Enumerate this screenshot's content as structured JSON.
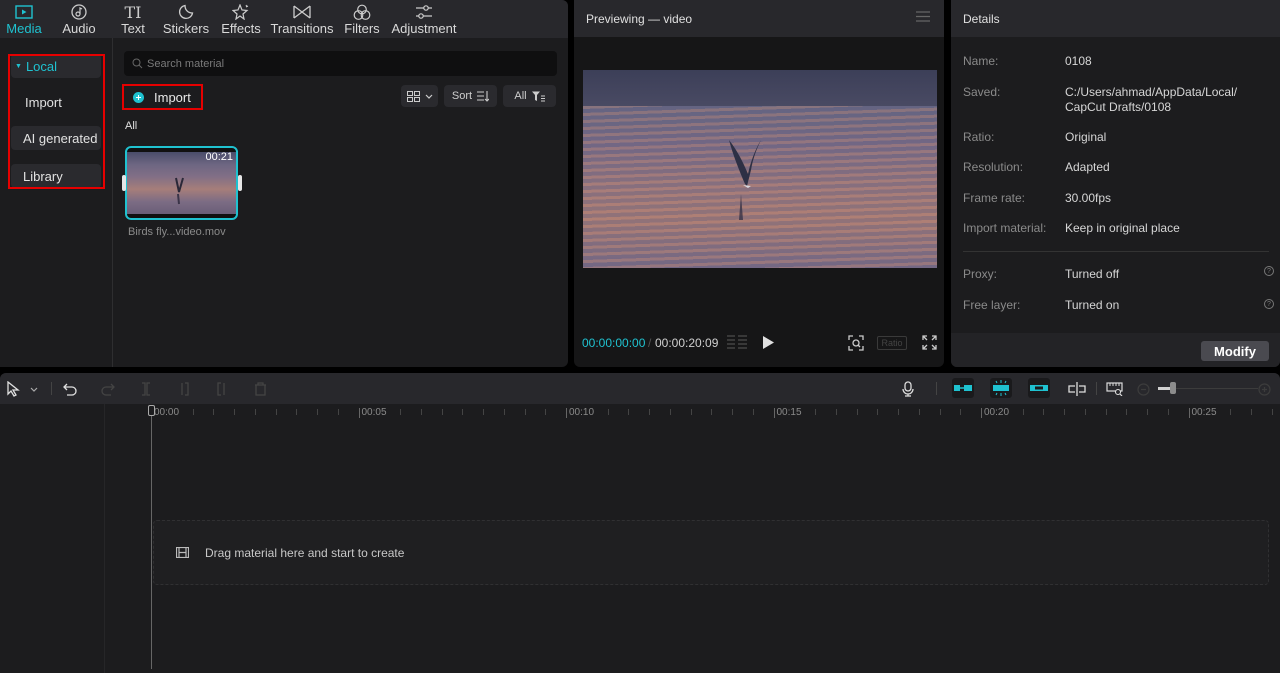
{
  "media_tabs": [
    {
      "label": "Media",
      "icon": "media-icon",
      "active": true
    },
    {
      "label": "Audio",
      "icon": "audio-icon",
      "active": false
    },
    {
      "label": "Text",
      "icon": "text-icon",
      "active": false
    },
    {
      "label": "Stickers",
      "icon": "stickers-icon",
      "active": false
    },
    {
      "label": "Effects",
      "icon": "effects-icon",
      "active": false
    },
    {
      "label": "Transitions",
      "icon": "transitions-icon",
      "active": false
    },
    {
      "label": "Filters",
      "icon": "filters-icon",
      "active": false
    },
    {
      "label": "Adjustment",
      "icon": "adjustment-icon",
      "active": false
    }
  ],
  "sidebar": {
    "items": [
      {
        "label": "Local",
        "expanded": true
      },
      {
        "label": "Import"
      },
      {
        "label": "AI generated"
      },
      {
        "label": "Library"
      }
    ]
  },
  "media": {
    "search_placeholder": "Search material",
    "import_label": "Import",
    "sort_label": "Sort",
    "filter_label": "All",
    "section_label": "All",
    "items": [
      {
        "name": "Birds fly...video.mov",
        "duration": "00:21"
      }
    ]
  },
  "preview": {
    "title": "Previewing — video",
    "current_time": "00:00:00:00",
    "separator": "/",
    "total_time": "00:00:20:09",
    "ratio_label": "Ratio"
  },
  "details": {
    "title": "Details",
    "rows": [
      {
        "key": "Name:",
        "value": "0108"
      },
      {
        "key": "Saved:",
        "value": "C:/Users/ahmad/AppData/Local/ CapCut Drafts/0108"
      },
      {
        "key": "Ratio:",
        "value": "Original"
      },
      {
        "key": "Resolution:",
        "value": "Adapted"
      },
      {
        "key": "Frame rate:",
        "value": "30.00fps"
      },
      {
        "key": "Import material:",
        "value": "Keep in original place"
      },
      {
        "key": "Proxy:",
        "value": "Turned off"
      },
      {
        "key": "Free layer:",
        "value": "Turned on"
      }
    ],
    "modify_label": "Modify"
  },
  "timeline": {
    "ruler_labels": [
      "00:00",
      "00:05",
      "00:10",
      "00:15",
      "00:20",
      "00:25"
    ],
    "drop_hint": "Drag material here and start to create",
    "zoom_level": 0.15
  },
  "colors": {
    "accent": "#1fc2d0",
    "highlight_box": "#e60000"
  }
}
